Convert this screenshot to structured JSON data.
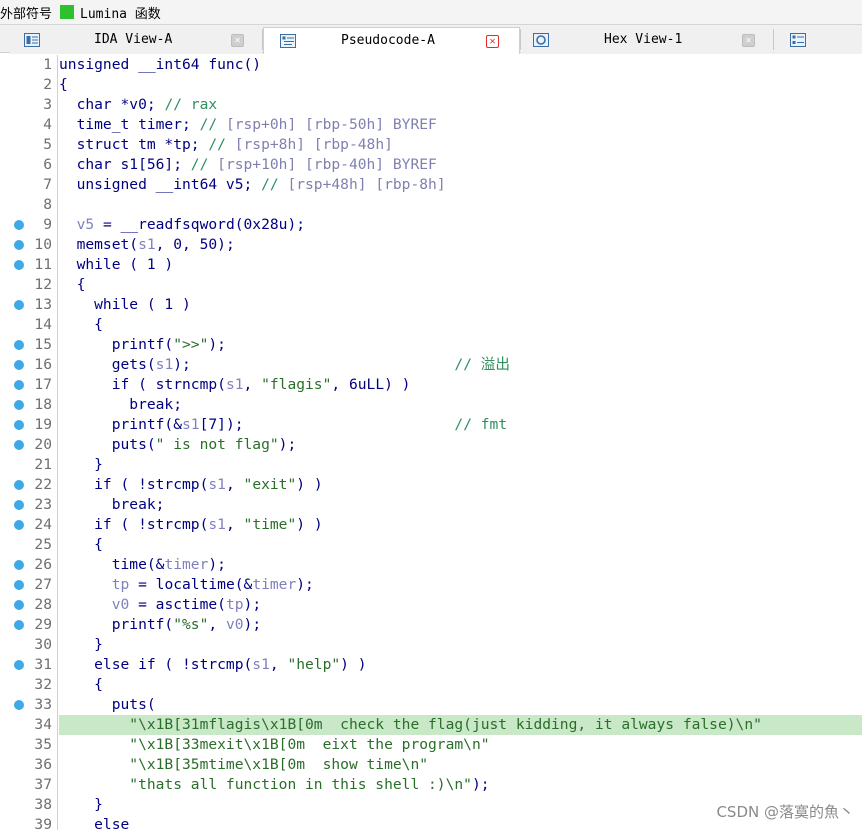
{
  "legend": {
    "prefix_text": "外部符号",
    "swatch_color": "#2ec02e",
    "lumina_text": "Lumina 函数"
  },
  "tabs": [
    {
      "label": "IDA View-A",
      "icon": "ida-view-icon",
      "active": false
    },
    {
      "label": "Pseudocode-A",
      "icon": "pseudocode-icon",
      "active": true
    },
    {
      "label": "Hex View-1",
      "icon": "hex-view-icon",
      "active": false
    },
    {
      "label": "",
      "icon": "structures-icon",
      "active": false
    }
  ],
  "code": {
    "highlight_line": 34,
    "breakpoint_color": "#3fa9e8",
    "lines": [
      {
        "n": "1",
        "bp": false,
        "segs": [
          [
            "kw",
            "unsigned __int64 func()"
          ]
        ]
      },
      {
        "n": "2",
        "bp": false,
        "segs": [
          [
            "kw",
            "{"
          ]
        ]
      },
      {
        "n": "3",
        "bp": false,
        "segs": [
          [
            "kw",
            "  char *v0; "
          ],
          [
            "cmt",
            "// rax"
          ]
        ]
      },
      {
        "n": "4",
        "bp": false,
        "segs": [
          [
            "kw",
            "  time_t timer; "
          ],
          [
            "cmt",
            "// "
          ],
          [
            "addr",
            "[rsp+0h] [rbp-50h] BYREF"
          ]
        ]
      },
      {
        "n": "5",
        "bp": false,
        "segs": [
          [
            "kw",
            "  struct tm *tp; "
          ],
          [
            "cmt",
            "// "
          ],
          [
            "addr",
            "[rsp+8h] [rbp-48h]"
          ]
        ]
      },
      {
        "n": "6",
        "bp": false,
        "segs": [
          [
            "kw",
            "  char s1[56]; "
          ],
          [
            "cmt",
            "// "
          ],
          [
            "addr",
            "[rsp+10h] [rbp-40h] BYREF"
          ]
        ]
      },
      {
        "n": "7",
        "bp": false,
        "segs": [
          [
            "kw",
            "  unsigned __int64 v5; "
          ],
          [
            "cmt",
            "// "
          ],
          [
            "addr",
            "[rsp+48h] [rbp-8h]"
          ]
        ]
      },
      {
        "n": "8",
        "bp": false,
        "segs": []
      },
      {
        "n": "9",
        "bp": true,
        "segs": [
          [
            "var",
            "  v5"
          ],
          [
            "kw",
            " = __readfsqword(0x28u);"
          ]
        ]
      },
      {
        "n": "10",
        "bp": true,
        "segs": [
          [
            "kw",
            "  memset("
          ],
          [
            "var",
            "s1"
          ],
          [
            "kw",
            ", 0, 50);"
          ]
        ]
      },
      {
        "n": "11",
        "bp": true,
        "segs": [
          [
            "kw",
            "  while ( 1 )"
          ]
        ]
      },
      {
        "n": "12",
        "bp": false,
        "segs": [
          [
            "kw",
            "  {"
          ]
        ]
      },
      {
        "n": "13",
        "bp": true,
        "segs": [
          [
            "kw",
            "    while ( 1 )"
          ]
        ]
      },
      {
        "n": "14",
        "bp": false,
        "segs": [
          [
            "kw",
            "    {"
          ]
        ]
      },
      {
        "n": "15",
        "bp": true,
        "segs": [
          [
            "kw",
            "      printf("
          ],
          [
            "str",
            "\">>\""
          ],
          [
            "kw",
            ");"
          ]
        ]
      },
      {
        "n": "16",
        "bp": true,
        "segs": [
          [
            "kw",
            "      gets("
          ],
          [
            "var",
            "s1"
          ],
          [
            "kw",
            ");                              "
          ],
          [
            "cmt",
            "// 溢出"
          ]
        ]
      },
      {
        "n": "17",
        "bp": true,
        "segs": [
          [
            "kw",
            "      if ( strncmp("
          ],
          [
            "var",
            "s1"
          ],
          [
            "kw",
            ", "
          ],
          [
            "str",
            "\"flagis\""
          ],
          [
            "kw",
            ", 6uLL) )"
          ]
        ]
      },
      {
        "n": "18",
        "bp": true,
        "segs": [
          [
            "kw",
            "        break;"
          ]
        ]
      },
      {
        "n": "19",
        "bp": true,
        "segs": [
          [
            "kw",
            "      printf(&"
          ],
          [
            "var",
            "s1"
          ],
          [
            "kw",
            "[7]);                        "
          ],
          [
            "cmt",
            "// fmt"
          ]
        ]
      },
      {
        "n": "20",
        "bp": true,
        "segs": [
          [
            "kw",
            "      puts("
          ],
          [
            "str",
            "\" is not flag\""
          ],
          [
            "kw",
            ");"
          ]
        ]
      },
      {
        "n": "21",
        "bp": false,
        "segs": [
          [
            "kw",
            "    }"
          ]
        ]
      },
      {
        "n": "22",
        "bp": true,
        "segs": [
          [
            "kw",
            "    if ( !strcmp("
          ],
          [
            "var",
            "s1"
          ],
          [
            "kw",
            ", "
          ],
          [
            "str",
            "\"exit\""
          ],
          [
            "kw",
            ") )"
          ]
        ]
      },
      {
        "n": "23",
        "bp": true,
        "segs": [
          [
            "kw",
            "      break;"
          ]
        ]
      },
      {
        "n": "24",
        "bp": true,
        "segs": [
          [
            "kw",
            "    if ( !strcmp("
          ],
          [
            "var",
            "s1"
          ],
          [
            "kw",
            ", "
          ],
          [
            "str",
            "\"time\""
          ],
          [
            "kw",
            ") )"
          ]
        ]
      },
      {
        "n": "25",
        "bp": false,
        "segs": [
          [
            "kw",
            "    {"
          ]
        ]
      },
      {
        "n": "26",
        "bp": true,
        "segs": [
          [
            "kw",
            "      time(&"
          ],
          [
            "var",
            "timer"
          ],
          [
            "kw",
            ");"
          ]
        ]
      },
      {
        "n": "27",
        "bp": true,
        "segs": [
          [
            "var",
            "      tp"
          ],
          [
            "kw",
            " = localtime(&"
          ],
          [
            "var",
            "timer"
          ],
          [
            "kw",
            ");"
          ]
        ]
      },
      {
        "n": "28",
        "bp": true,
        "segs": [
          [
            "var",
            "      v0"
          ],
          [
            "kw",
            " = asctime("
          ],
          [
            "var",
            "tp"
          ],
          [
            "kw",
            ");"
          ]
        ]
      },
      {
        "n": "29",
        "bp": true,
        "segs": [
          [
            "kw",
            "      printf("
          ],
          [
            "str",
            "\"%s\""
          ],
          [
            "kw",
            ", "
          ],
          [
            "var",
            "v0"
          ],
          [
            "kw",
            ");"
          ]
        ]
      },
      {
        "n": "30",
        "bp": false,
        "segs": [
          [
            "kw",
            "    }"
          ]
        ]
      },
      {
        "n": "31",
        "bp": true,
        "segs": [
          [
            "kw",
            "    else if ( !strcmp("
          ],
          [
            "var",
            "s1"
          ],
          [
            "kw",
            ", "
          ],
          [
            "str",
            "\"help\""
          ],
          [
            "kw",
            ") )"
          ]
        ]
      },
      {
        "n": "32",
        "bp": false,
        "segs": [
          [
            "kw",
            "    {"
          ]
        ]
      },
      {
        "n": "33",
        "bp": true,
        "segs": [
          [
            "kw",
            "      puts("
          ]
        ]
      },
      {
        "n": "34",
        "bp": false,
        "segs": [
          [
            "str",
            "        \"\\x1B[31mflagis\\x1B[0m  check the flag(just kidding, it always false)\\n\""
          ]
        ]
      },
      {
        "n": "35",
        "bp": false,
        "segs": [
          [
            "str",
            "        \"\\x1B[33mexit\\x1B[0m  eixt the program\\n\""
          ]
        ]
      },
      {
        "n": "36",
        "bp": false,
        "segs": [
          [
            "str",
            "        \"\\x1B[35mtime\\x1B[0m  show time\\n\""
          ]
        ]
      },
      {
        "n": "37",
        "bp": false,
        "segs": [
          [
            "str",
            "        \"thats all function in this shell :)\\n\""
          ],
          [
            "kw",
            ");"
          ]
        ]
      },
      {
        "n": "38",
        "bp": false,
        "segs": [
          [
            "kw",
            "    }"
          ]
        ]
      },
      {
        "n": "39",
        "bp": false,
        "segs": [
          [
            "kw",
            "    else"
          ]
        ]
      }
    ]
  },
  "watermark": "CSDN @落寞的魚丶"
}
